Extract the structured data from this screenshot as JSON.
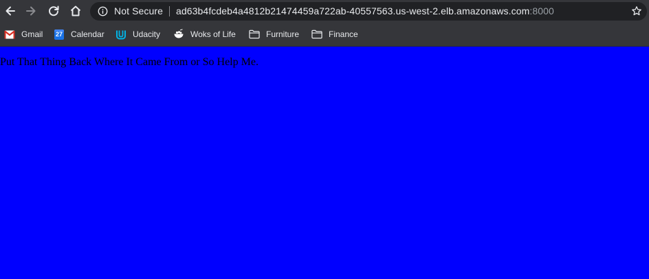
{
  "toolbar": {
    "back_icon": "arrow-left-icon",
    "forward_icon": "arrow-right-icon",
    "reload_icon": "reload-icon",
    "home_icon": "home-icon"
  },
  "omnibox": {
    "security_icon": "info-circle-icon",
    "security_label": "Not Secure",
    "url_host": "ad63b4fcdeb4a4812b21474459a722ab-40557563.us-west-2.elb.amazonaws.com",
    "url_port": ":8000",
    "bookmark_icon": "star-icon"
  },
  "bookmarks": [
    {
      "label": "Gmail",
      "icon": "gmail-icon"
    },
    {
      "label": "Calendar",
      "icon": "calendar-icon",
      "icon_text": "27"
    },
    {
      "label": "Udacity",
      "icon": "udacity-icon"
    },
    {
      "label": "Woks of Life",
      "icon": "bowl-icon"
    },
    {
      "label": "Furniture",
      "icon": "folder-icon"
    },
    {
      "label": "Finance",
      "icon": "folder-icon"
    }
  ],
  "page": {
    "text": "Put That Thing Back Where It Came From or So Help Me.",
    "background": "#0000ff",
    "text_color": "#000000"
  },
  "colors": {
    "chrome_bg": "#35363a",
    "omnibox_bg": "#202124",
    "text": "#e8eaed",
    "muted_text": "#9aa0a6"
  }
}
